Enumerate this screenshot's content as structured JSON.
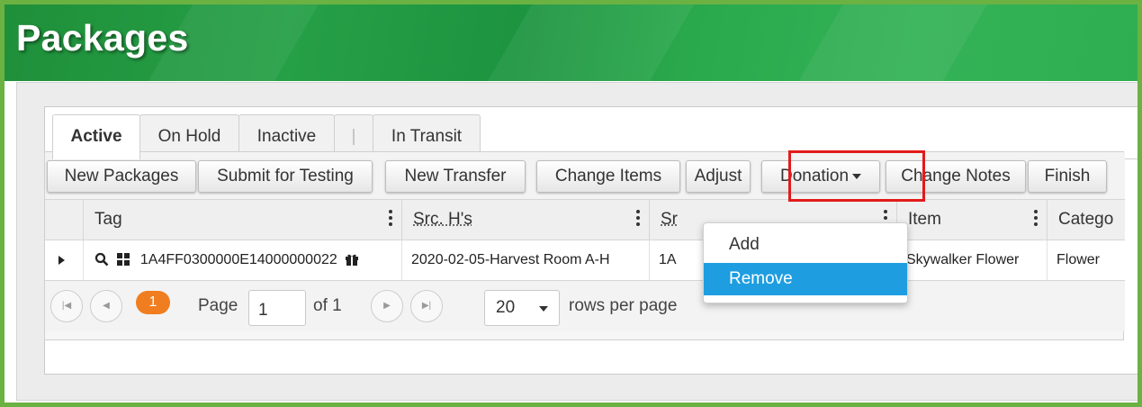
{
  "page": {
    "title": "Packages"
  },
  "tabs": [
    {
      "label": "Active"
    },
    {
      "label": "On Hold"
    },
    {
      "label": "Inactive"
    },
    {
      "label": "|"
    },
    {
      "label": "In Transit"
    }
  ],
  "toolbar": {
    "new_packages": "New Packages",
    "submit_for_testing": "Submit for Testing",
    "new_transfer": "New Transfer",
    "change_items": "Change Items",
    "adjust": "Adjust",
    "donation": "Donation",
    "change_notes": "Change Notes",
    "finish": "Finish"
  },
  "columns": {
    "tag": "Tag",
    "src_hs": "Src. H's",
    "src_pkgs": "Sr",
    "item": "Item",
    "category": "Catego"
  },
  "row": {
    "tag": "1A4FF0300000E14000000022",
    "src_hs": "2020-02-05-Harvest Room A-H",
    "src_pkgs": "1A",
    "item": "Skywalker Flower",
    "category": "Flower"
  },
  "dropdown": {
    "items": [
      {
        "label": "Add"
      },
      {
        "label": "Remove"
      }
    ],
    "active_index": 1
  },
  "pager": {
    "current_page": "1",
    "page_label": "Page",
    "page_value": "1",
    "of_label": "of 1",
    "rows_per_page": "20",
    "rows_label": "rows per page"
  },
  "colors": {
    "accent_green": "#6bb243",
    "highlight_red": "#e21b1b",
    "menu_active": "#1e9ee0",
    "page_badge": "#f07d1f"
  }
}
